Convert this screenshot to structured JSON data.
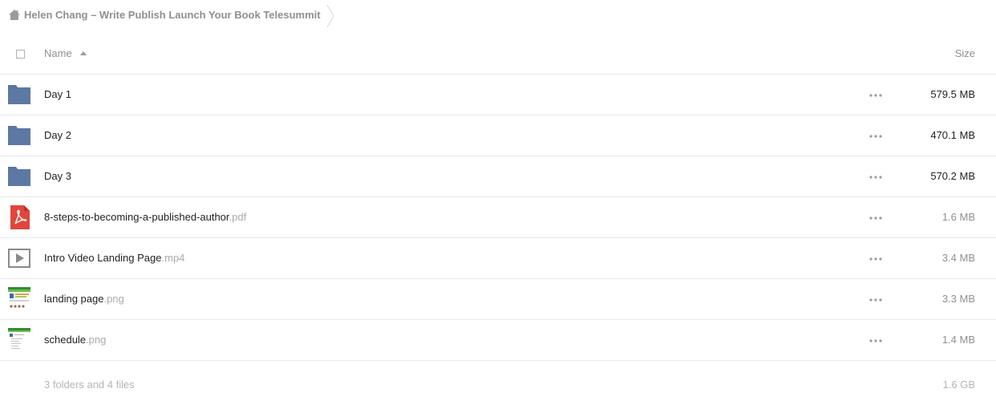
{
  "breadcrumb": {
    "title": "Helen Chang – Write Publish Launch Your Book Telesummit"
  },
  "header": {
    "name_label": "Name",
    "size_label": "Size"
  },
  "files": [
    {
      "name": "Day 1",
      "ext": "",
      "size": "579.5 MB",
      "type": "folder",
      "icon": "folder-icon"
    },
    {
      "name": "Day 2",
      "ext": "",
      "size": "470.1 MB",
      "type": "folder",
      "icon": "folder-icon"
    },
    {
      "name": "Day 3",
      "ext": "",
      "size": "570.2 MB",
      "type": "folder",
      "icon": "folder-icon"
    },
    {
      "name": "8-steps-to-becoming-a-published-author",
      "ext": ".pdf",
      "size": "1.6 MB",
      "type": "pdf",
      "icon": "pdf-icon"
    },
    {
      "name": "Intro Video Landing Page",
      "ext": ".mp4",
      "size": "3.4 MB",
      "type": "video",
      "icon": "video-icon"
    },
    {
      "name": "landing page",
      "ext": ".png",
      "size": "3.3 MB",
      "type": "image",
      "icon": "image-thumbnail-icon"
    },
    {
      "name": "schedule",
      "ext": ".png",
      "size": "1.4 MB",
      "type": "image",
      "icon": "image-thumbnail-icon"
    }
  ],
  "footer": {
    "summary": "3 folders and 4 files",
    "total": "1.6 GB"
  },
  "colors": {
    "folder": "#5a76a0",
    "pdf": "#e0463b",
    "muted_text": "#8f8f8f",
    "divider": "#e8e8e8"
  }
}
